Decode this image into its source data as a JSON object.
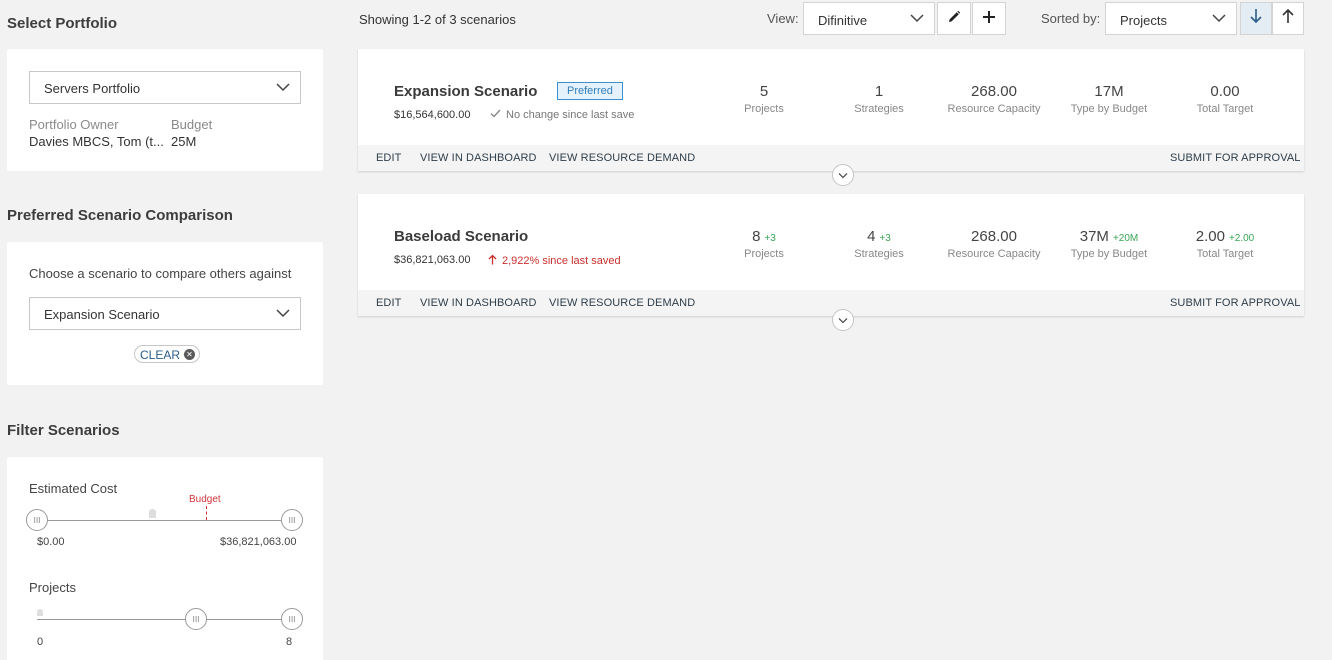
{
  "portfolio": {
    "section_title": "Select Portfolio",
    "selected": "Servers Portfolio",
    "owner_label": "Portfolio Owner",
    "owner_value": "Davies MBCS, Tom (t...",
    "budget_label": "Budget",
    "budget_value": "25M"
  },
  "comparison": {
    "section_title": "Preferred Scenario Comparison",
    "prompt": "Choose a scenario to compare others against",
    "selected": "Expansion Scenario",
    "clear_label": "CLEAR"
  },
  "filters": {
    "section_title": "Filter Scenarios",
    "estimated_cost": {
      "label": "Estimated Cost",
      "min_label": "$0.00",
      "max_label": "$36,821,063.00",
      "budget_label": "Budget",
      "range_low": 0,
      "range_high": 1.0,
      "budget_position": 0.68
    },
    "projects": {
      "label": "Projects",
      "min_label": "0",
      "max_label": "8",
      "range_low": 0.62,
      "range_high": 1.0
    }
  },
  "toolbar": {
    "showing": "Showing 1-2 of 3 scenarios",
    "view_label": "View:",
    "view_value": "Difinitive",
    "sorted_label": "Sorted by:",
    "sorted_value": "Projects"
  },
  "scenarios": [
    {
      "name": "Expansion Scenario",
      "badge": "Preferred",
      "cost": "$16,564,600.00",
      "status": "No change since last save",
      "metrics": [
        {
          "value": "5",
          "delta": "",
          "label": "Projects"
        },
        {
          "value": "1",
          "delta": "",
          "label": "Strategies"
        },
        {
          "value": "268.00",
          "delta": "",
          "label": "Resource Capacity"
        },
        {
          "value": "17M",
          "delta": "",
          "label": "Type by Budget"
        },
        {
          "value": "0.00",
          "delta": "",
          "label": "Total Target"
        }
      ],
      "actions": [
        "EDIT",
        "VIEW IN DASHBOARD",
        "VIEW RESOURCE DEMAND"
      ],
      "submit": "SUBMIT FOR APPROVAL"
    },
    {
      "name": "Baseload Scenario",
      "badge": "",
      "cost": "$36,821,063.00",
      "status": "2,922% since last saved",
      "metrics": [
        {
          "value": "8",
          "delta": "+3",
          "label": "Projects"
        },
        {
          "value": "4",
          "delta": "+3",
          "label": "Strategies"
        },
        {
          "value": "268.00",
          "delta": "",
          "label": "Resource Capacity"
        },
        {
          "value": "37M",
          "delta": "+20M",
          "label": "Type by Budget"
        },
        {
          "value": "2.00",
          "delta": "+2.00",
          "label": "Total Target"
        }
      ],
      "actions": [
        "EDIT",
        "VIEW IN DASHBOARD",
        "VIEW RESOURCE DEMAND"
      ],
      "submit": "SUBMIT FOR APPROVAL"
    }
  ],
  "colors": {
    "accent": "#2f7fc0",
    "positive": "#3aa655",
    "negative": "#c9302c",
    "budget": "#d13438"
  }
}
